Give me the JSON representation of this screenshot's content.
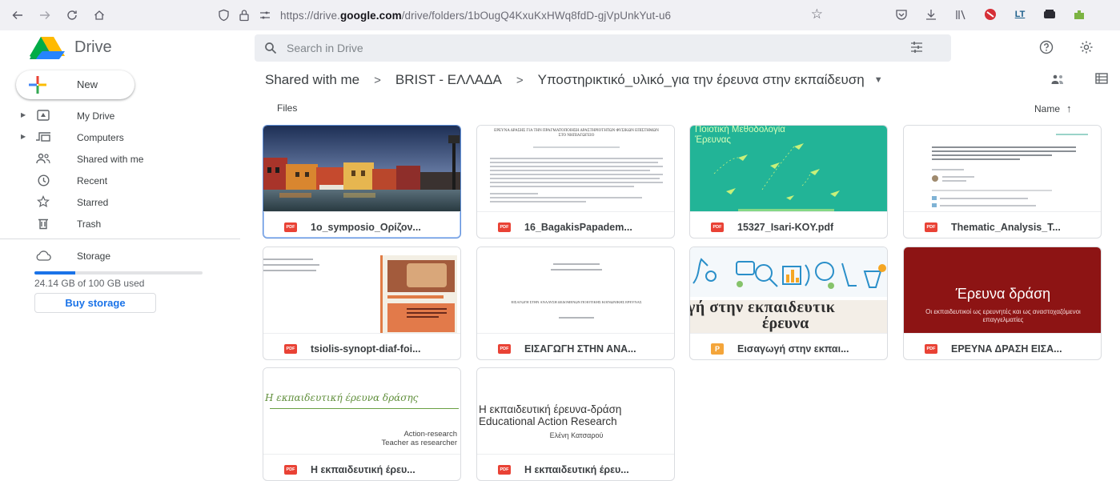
{
  "browser": {
    "url_prefix": "https://drive.",
    "url_domain": "google.com",
    "url_path": "/drive/folders/1bOugQ4KxuKxHWq8fdD-gjVpUnkYut-u6"
  },
  "app": {
    "title": "Drive",
    "search_placeholder": "Search in Drive"
  },
  "sidebar": {
    "new_label": "New",
    "items": [
      {
        "label": "My Drive",
        "icon": "my-drive-icon"
      },
      {
        "label": "Computers",
        "icon": "computer-icon"
      },
      {
        "label": "Shared with me",
        "icon": "shared-icon"
      },
      {
        "label": "Recent",
        "icon": "clock-icon"
      },
      {
        "label": "Starred",
        "icon": "star-icon"
      },
      {
        "label": "Trash",
        "icon": "trash-icon"
      },
      {
        "label": "Storage",
        "icon": "cloud-icon"
      }
    ],
    "storage_used_fraction": 0.2414,
    "storage_text": "24.14 GB of 100 GB used",
    "buy_storage": "Buy storage"
  },
  "breadcrumb": {
    "root": "Shared with me",
    "parent": "BRIST - ΕΛΛΑΔΑ",
    "current": "Υποστηρικτικό_υλικό_για την έρευνα στην εκπαίδευση"
  },
  "main": {
    "section_label": "Files",
    "sort_label": "Name",
    "files": [
      {
        "name": "1o_symposio_Ορίζον...",
        "type": "PDF"
      },
      {
        "name": "16_BagakisPapadem...",
        "type": "PDF"
      },
      {
        "name": "15327_Isari-KOY.pdf",
        "type": "PDF"
      },
      {
        "name": "Thematic_Analysis_T...",
        "type": "PDF"
      },
      {
        "name": "tsiolis-synopt-diaf-foi...",
        "type": "PDF"
      },
      {
        "name": "ΕΙΣΑΓΩΓΗ ΣΤΗΝ ΑΝΑ...",
        "type": "PDF"
      },
      {
        "name": "Εισαγωγή στην εκπαι...",
        "type": "P"
      },
      {
        "name": "ΕΡΕΥΝΑ ΔΡΑΣΗ ΕΙΣΑ...",
        "type": "PDF"
      },
      {
        "name": "Η εκπαιδευτική έρευ...",
        "type": "PDF"
      },
      {
        "name": "Η εκπαιδευτική έρευ...",
        "type": "PDF"
      }
    ]
  },
  "thumbs": {
    "t2_title": "ΕΡΕΥΝΑ ΔΡΑΣΗΣ ΓΙΑ ΤΗΝ ΠΡΑΓΜΑΤΟΠΟΙΗΣΗ ΔΡΑΣΤΗΡΙΟΤΗΤΩΝ ΦΥΣΙΚΩΝ ΕΠΙΣΤΗΜΩΝ ΣΤΟ ΝΗΠΙΑΓΩΓΕΙΟ",
    "t3_title": "Ποιοτική Μεθοδολογία Έρευνας",
    "t6_title": "ΕΙΣΑΓΩΓΗ ΣΤΗΝ ΑΝΑΛΥΣΗ ΔΕΔΟΜΕΝΩΝ ΠΟΙΟΤΙΚΗΣ ΚΟΙΝΩΝΙΚΗΣ ΕΡΕΥΝΑΣ",
    "t7_text1": "γή στην εκπαιδευτικ",
    "t7_text2": "έρευνα",
    "t8_title": "Έρευνα δράση",
    "t8_sub": "Οι εκπαιδευτικοί ως ερευνητές και ως αναστοχαζόμενοι επαγγελματίες",
    "t9_title": "Η εκπαιδευτική έρευνα δράσης",
    "t9_line1": "Action-research",
    "t9_line2": "Teacher as researcher",
    "t10_title1": "Η εκπαιδευτική έρευνα-δράση",
    "t10_title2": "Educational Action Research",
    "t10_author": "Ελένη Κατσαρού"
  },
  "colors": {
    "accent": "#1a73e8",
    "pdf": "#e94235",
    "slides": "#f4a53a",
    "teal": "#26b89a",
    "maroon": "#8b1515"
  }
}
